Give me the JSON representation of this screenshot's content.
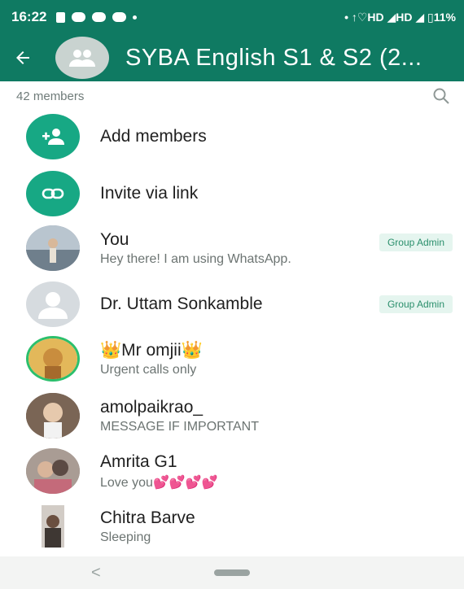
{
  "status_bar": {
    "time": "16:22",
    "right_text": "• ↑♡HD ◢HD ◢ ▯11%"
  },
  "header": {
    "title": "SYBA English S1 & S2 (2..."
  },
  "members_count": "42 members",
  "actions": [
    {
      "label": "Add members",
      "icon": "add-person-icon"
    },
    {
      "label": "Invite via link",
      "icon": "link-icon"
    }
  ],
  "members": [
    {
      "name": "You",
      "status": "Hey there! I am using WhatsApp.",
      "badge": "Group Admin"
    },
    {
      "name": "Dr. Uttam Sonkamble",
      "status": "",
      "badge": "Group Admin"
    },
    {
      "name": "👑Mr omjii👑",
      "status": "Urgent calls only",
      "badge": ""
    },
    {
      "name": "amolpaikrao_",
      "status": "MESSAGE IF IMPORTANT",
      "badge": ""
    },
    {
      "name": "Amrita G1",
      "status": "Love you💕💕💕💕",
      "badge": ""
    },
    {
      "name": "Chitra Barve",
      "status": "Sleeping",
      "badge": ""
    }
  ],
  "colors": {
    "primary": "#0f7a62",
    "accent": "#17a884",
    "badge_bg": "#e5f5ef",
    "badge_text": "#2b8f6c"
  },
  "nav": {
    "back_glyph": "<"
  }
}
